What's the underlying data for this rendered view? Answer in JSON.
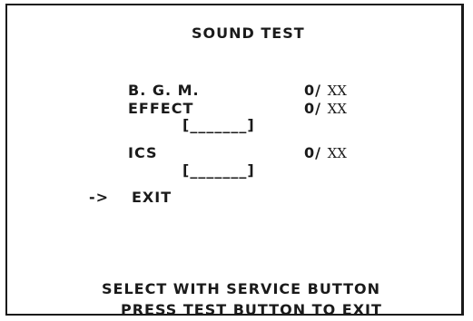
{
  "screen": {
    "title": "SOUND TEST",
    "rows": [
      {
        "label": "B. G. M.",
        "current": "0",
        "separator": "/",
        "max": "XX"
      },
      {
        "label": "EFFECT",
        "current": "0",
        "separator": "/",
        "max": "XX"
      },
      {
        "bracket": "[_______]"
      },
      {
        "label": "ICS",
        "current": "0",
        "separator": "/",
        "max": "XX"
      },
      {
        "bracket": "[_______]"
      }
    ],
    "cursor": "->",
    "exit_label": "EXIT",
    "footer": {
      "line1": "SELECT WITH SERVICE BUTTON",
      "line2": "PRESS TEST BUTTON TO EXIT"
    }
  }
}
